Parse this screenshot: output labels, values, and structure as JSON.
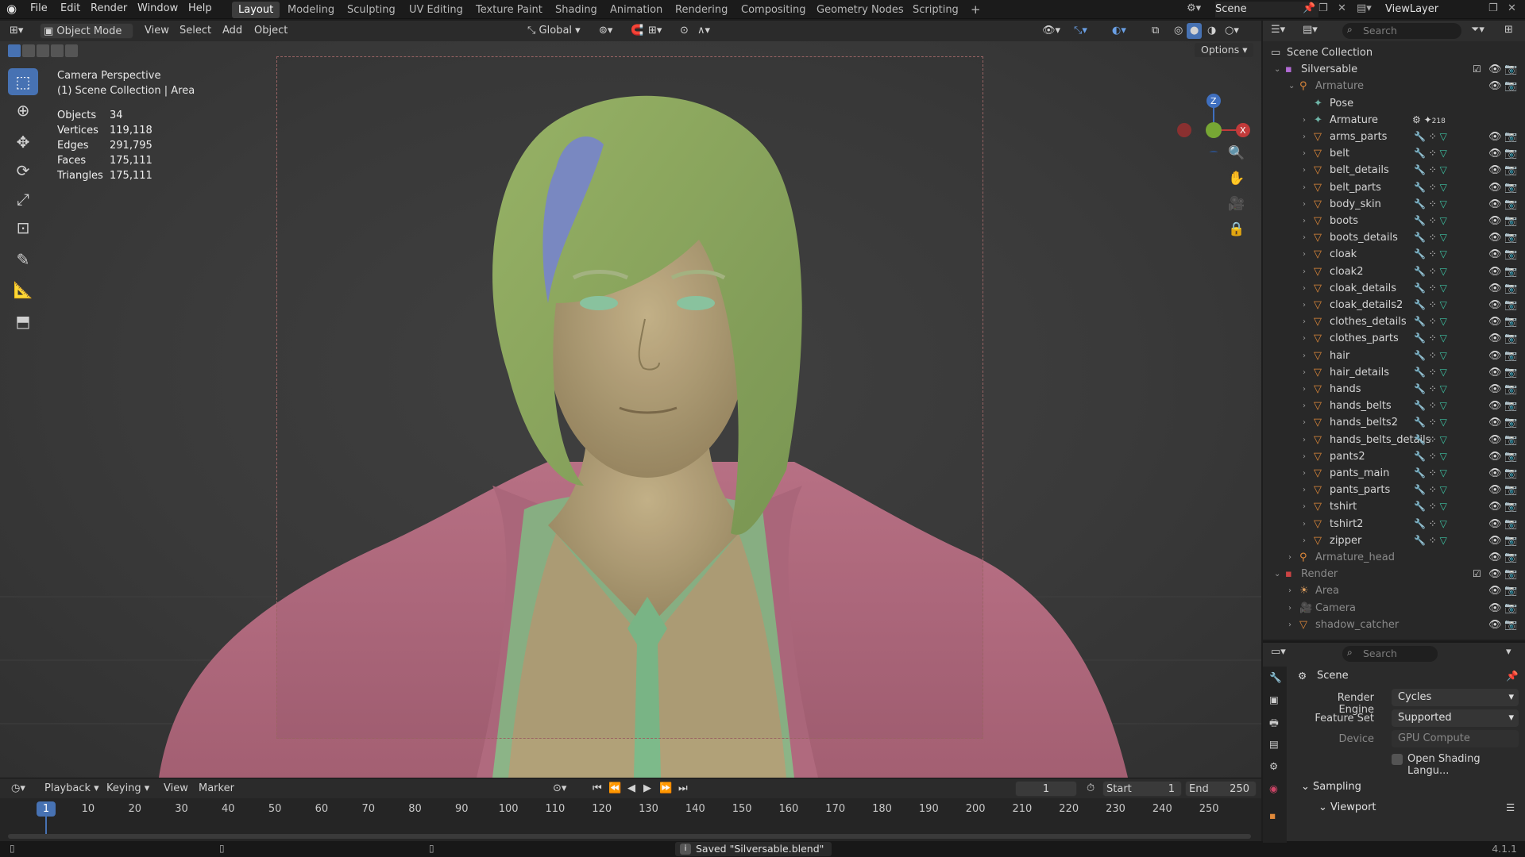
{
  "topbar": {
    "menus": [
      "File",
      "Edit",
      "Render",
      "Window",
      "Help"
    ],
    "workspaces": [
      "Layout",
      "Modeling",
      "Sculpting",
      "UV Editing",
      "Texture Paint",
      "Shading",
      "Animation",
      "Rendering",
      "Compositing",
      "Geometry Nodes",
      "Scripting"
    ],
    "active_workspace": "Layout",
    "add_workspace": "+",
    "scene": "Scene",
    "view_layer": "ViewLayer"
  },
  "viewport_header": {
    "mode": "Object Mode",
    "menus": [
      "View",
      "Select",
      "Add",
      "Object"
    ],
    "orientation": "Global",
    "options": "Options"
  },
  "viewport": {
    "camera_label": "Camera Perspective",
    "collection_label": "(1) Scene Collection | Area",
    "stats": [
      {
        "label": "Objects",
        "value": "34"
      },
      {
        "label": "Vertices",
        "value": "119,118"
      },
      {
        "label": "Edges",
        "value": "291,795"
      },
      {
        "label": "Faces",
        "value": "175,111"
      },
      {
        "label": "Triangles",
        "value": "175,111"
      }
    ],
    "gizmo": {
      "z": "Z",
      "x": "X"
    }
  },
  "timeline": {
    "menus": [
      "Playback",
      "Keying",
      "View",
      "Marker"
    ],
    "current_frame": "1",
    "start_label": "Start",
    "start": "1",
    "end_label": "End",
    "end": "250",
    "ticks": [
      "1",
      "10",
      "20",
      "30",
      "40",
      "50",
      "60",
      "70",
      "80",
      "90",
      "100",
      "110",
      "120",
      "130",
      "140",
      "150",
      "160",
      "170",
      "180",
      "190",
      "200",
      "210",
      "220",
      "230",
      "240",
      "250"
    ]
  },
  "status": {
    "message": "Saved \"Silversable.blend\"",
    "version": "4.1.1"
  },
  "outliner": {
    "search_placeholder": "Search",
    "scene_collection": "Scene Collection",
    "collection": "Silversable",
    "armature": "Armature",
    "pose": "Pose",
    "armature_data": "Armature",
    "armature_data_count": "218",
    "objects": [
      "arms_parts",
      "belt",
      "belt_details",
      "belt_parts",
      "body_skin",
      "boots",
      "boots_details",
      "cloak",
      "cloak2",
      "cloak_details",
      "cloak_details2",
      "clothes_details",
      "clothes_parts",
      "hair",
      "hair_details",
      "hands",
      "hands_belts",
      "hands_belts2",
      "hands_belts_details",
      "pants2",
      "pants_main",
      "pants_parts",
      "tshirt",
      "tshirt2",
      "zipper"
    ],
    "armature_head": "Armature_head",
    "render_collection": "Render",
    "render_items": [
      "Area",
      "Camera",
      "shadow_catcher"
    ]
  },
  "properties": {
    "search_placeholder": "Search",
    "context": "Scene",
    "render_engine_label": "Render Engine",
    "render_engine": "Cycles",
    "feature_set_label": "Feature Set",
    "feature_set": "Supported",
    "device_label": "Device",
    "device": "GPU Compute",
    "osl_label": "Open Shading Langu...",
    "sampling": "Sampling",
    "viewport": "Viewport"
  },
  "colors": {
    "accent": "#4772b3",
    "hair": "#8fae62",
    "skin": "#b8a47e",
    "jacket": "#b36b80",
    "shirt": "#8db88a",
    "mesh_icon": "#e0893a"
  }
}
